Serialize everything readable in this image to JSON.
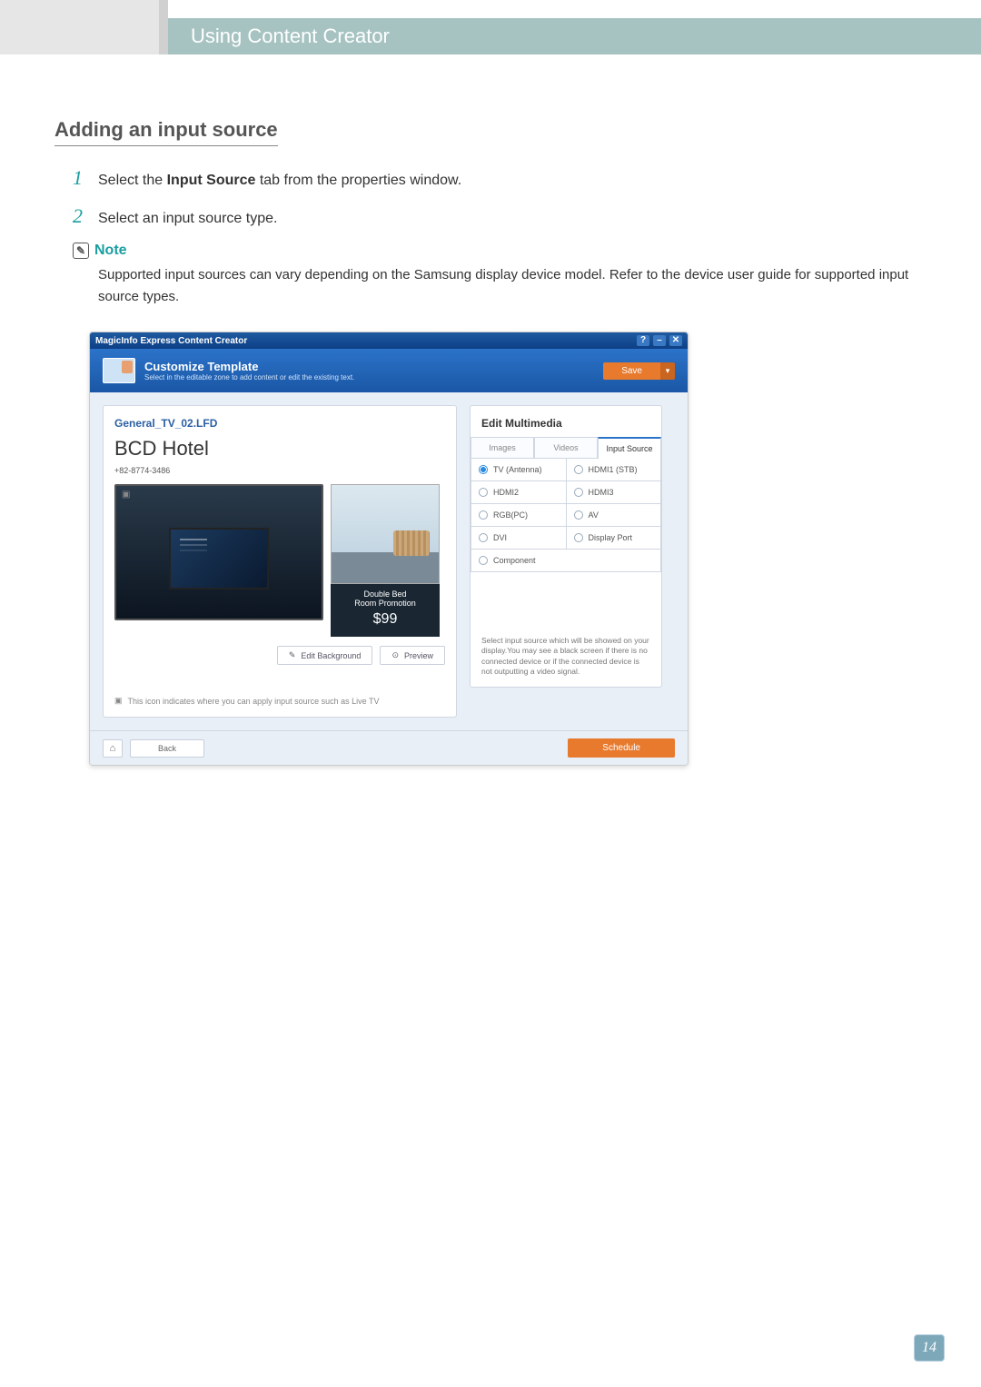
{
  "chapterTitle": "Using Content Creator",
  "sectionTitle": "Adding an input source",
  "steps": [
    {
      "num": "1",
      "pre": "Select the ",
      "bold": "Input Source",
      "post": " tab from the properties window."
    },
    {
      "num": "2",
      "pre": "Select an input source type.",
      "bold": "",
      "post": ""
    }
  ],
  "note": {
    "label": "Note",
    "body": "Supported input sources can vary depending on the Samsung display device model. Refer to the device user guide for supported input source types."
  },
  "app": {
    "titlebar": "MagicInfo Express Content Creator",
    "customize": {
      "title": "Customize Template",
      "subtitle": "Select in the editable zone to add content or edit the existing text."
    },
    "saveLabel": "Save",
    "fileName": "General_TV_02.LFD",
    "hotelName": "BCD Hotel",
    "phone": "+82-8774-3486",
    "promo": {
      "line1": "Double Bed",
      "line2": "Room Promotion",
      "price": "$99"
    },
    "editBackground": "Edit Background",
    "preview": "Preview",
    "hint": "This icon indicates where you can apply input source such as Live TV",
    "editMultimedia": "Edit Multimedia",
    "tabs": {
      "images": "Images",
      "videos": "Videos",
      "inputSource": "Input Source"
    },
    "sources": {
      "tvAntenna": "TV (Antenna)",
      "hdmi1": "HDMI1 (STB)",
      "hdmi2": "HDMI2",
      "hdmi3": "HDMI3",
      "rgbpc": "RGB(PC)",
      "av": "AV",
      "dvi": "DVI",
      "displayPort": "Display Port",
      "component": "Component"
    },
    "rightHint": "Select input source which will be showed on your display.You may see a black screen if there is no connected device or if the connected device is not outputting a video signal.",
    "back": "Back",
    "schedule": "Schedule"
  },
  "pageNumber": "14"
}
